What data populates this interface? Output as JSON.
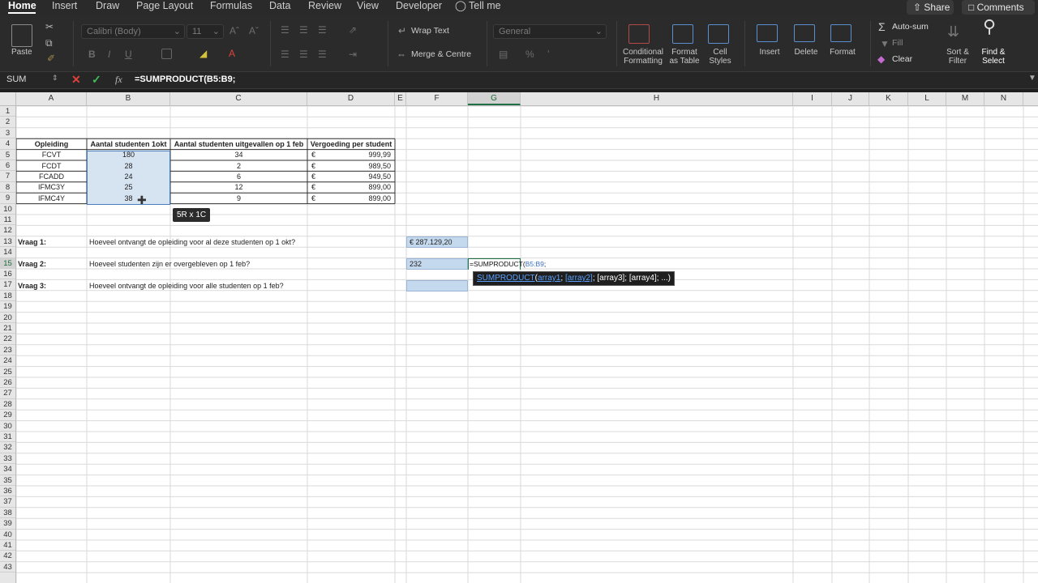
{
  "ribbon_tabs": [
    "Home",
    "Insert",
    "Draw",
    "Page Layout",
    "Formulas",
    "Data",
    "Review",
    "View",
    "Developer",
    "Tell me"
  ],
  "share_label": "Share",
  "comments_label": "Comments",
  "clipboard": {
    "paste_label": "Paste"
  },
  "font": {
    "name": "Calibri (Body)",
    "size": "11",
    "bold": "B",
    "italic": "I",
    "underline": "U"
  },
  "alignment": {
    "wrap_text": "Wrap Text",
    "merge_centre": "Merge & Centre"
  },
  "number": {
    "format": "General"
  },
  "styles": {
    "conditional": "Conditional",
    "formatting": "Formatting",
    "format_as": "Format",
    "as_table": "as Table",
    "cell": "Cell",
    "styles": "Styles"
  },
  "cells": {
    "insert": "Insert",
    "delete": "Delete",
    "format": "Format"
  },
  "editing": {
    "autosum": "Auto-sum",
    "fill": "Fill",
    "clear": "Clear",
    "sort1": "Sort &",
    "sort2": "Filter",
    "find1": "Find &",
    "find2": "Select"
  },
  "formula_bar": {
    "name_box": "SUM",
    "formula": "=SUMPRODUCT(B5:B9;"
  },
  "columns": [
    "A",
    "B",
    "C",
    "D",
    "E",
    "F",
    "G",
    "H",
    "I",
    "J",
    "K",
    "L",
    "M",
    "N"
  ],
  "rows": [
    "1",
    "2",
    "3",
    "4",
    "5",
    "6",
    "7",
    "8",
    "9",
    "10",
    "11",
    "12",
    "13",
    "14",
    "15",
    "16",
    "17",
    "18",
    "19",
    "20",
    "21",
    "22",
    "23",
    "24",
    "25",
    "26",
    "27",
    "28",
    "29",
    "30",
    "31",
    "32",
    "33",
    "34",
    "35",
    "36",
    "37",
    "38",
    "39",
    "40",
    "41",
    "42",
    "43"
  ],
  "table": {
    "headers": [
      "Opleiding",
      "Aantal studenten 1okt",
      "Aantal studenten uitgevallen op 1 feb",
      "Vergoeding per student"
    ],
    "rows": [
      {
        "a": "FCVT",
        "b": "180",
        "c": "34",
        "cur": "€",
        "d": "999,99"
      },
      {
        "a": "FCDT",
        "b": "28",
        "c": "2",
        "cur": "€",
        "d": "989,50"
      },
      {
        "a": "FCADD",
        "b": "24",
        "c": "6",
        "cur": "€",
        "d": "949,50"
      },
      {
        "a": "IFMC3Y",
        "b": "25",
        "c": "12",
        "cur": "€",
        "d": "899,00"
      },
      {
        "a": "IFMC4Y",
        "b": "38",
        "c": "9",
        "cur": "€",
        "d": "899,00"
      }
    ]
  },
  "questions": [
    {
      "label": "Vraag 1:",
      "text": "Hoeveel ontvangt de opleiding voor al deze studenten op 1 okt?",
      "answer": "€ 287.129,20"
    },
    {
      "label": "Vraag 2:",
      "text": "Hoeveel studenten zijn er overgebleven op 1 feb?",
      "answer": "232"
    },
    {
      "label": "Vraag 3:",
      "text": "Hoeveel ontvangt de opleiding voor alle studenten op 1 feb?",
      "answer": ""
    }
  ],
  "editing_cell": {
    "prefix": "=SUMPRODUCT(",
    "ref": "B5:B9",
    "suffix": ";"
  },
  "selection_tooltip": "5R x 1C",
  "function_tooltip": {
    "fn": "SUMPRODUCT",
    "open": "(",
    "arg1": "array1",
    "sep1": "; ",
    "arg2": "[array2]",
    "rest": "; [array3]; [array4]; ...)"
  }
}
